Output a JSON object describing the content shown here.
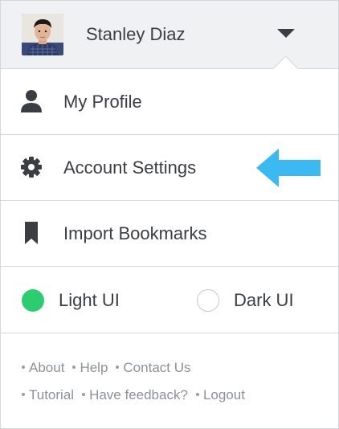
{
  "user": {
    "name": "Stanley Diaz"
  },
  "menu": {
    "items": [
      {
        "label": "My Profile",
        "icon": "person-icon"
      },
      {
        "label": "Account Settings",
        "icon": "gear-icon"
      },
      {
        "label": "Import Bookmarks",
        "icon": "bookmark-icon"
      }
    ]
  },
  "theme": {
    "options": [
      {
        "label": "Light UI",
        "selected": true
      },
      {
        "label": "Dark UI",
        "selected": false
      }
    ]
  },
  "footer": {
    "links": [
      "About",
      "Help",
      "Contact Us",
      "Tutorial",
      "Have feedback?",
      "Logout"
    ]
  },
  "colors": {
    "header_bg": "#f0f1f3",
    "accent_green": "#2ecc71",
    "arrow_blue": "#3bb9f0",
    "border": "#d3d6da",
    "icon": "#3a3d42"
  }
}
